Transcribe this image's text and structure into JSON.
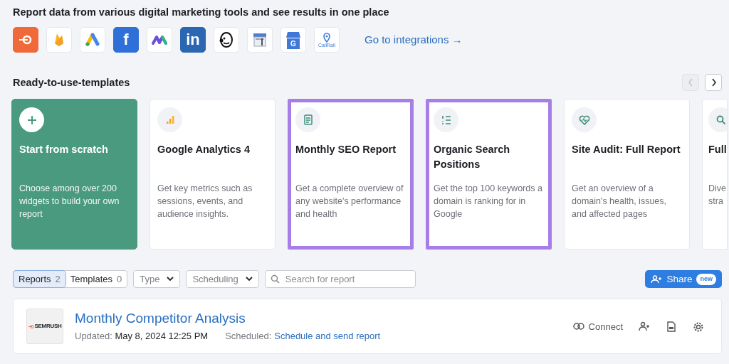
{
  "heading": "Report data from various digital marketing tools and see results in one place",
  "integrations": [
    {
      "kind": "swirl"
    },
    {
      "kind": "flame"
    },
    {
      "kind": "ads"
    },
    {
      "kind": "letter",
      "glyph": "f"
    },
    {
      "kind": "wave"
    },
    {
      "kind": "letter-box",
      "glyph": "in"
    },
    {
      "kind": "monkey"
    },
    {
      "kind": "store-tool"
    },
    {
      "kind": "store",
      "glyph": "G"
    },
    {
      "kind": "pin",
      "glyph": "CallRail"
    }
  ],
  "integrations_link": "Go to integrations →",
  "templates_heading": "Ready-to-use-templates",
  "carousel": {
    "prev_disabled": true,
    "next_disabled": false
  },
  "templates": [
    {
      "kind": "scratch",
      "title": "Start from scratch",
      "description": "Choose among over 200 widgets to build your own report",
      "highlighted": false
    },
    {
      "kind": "template",
      "title": "Google Analytics 4",
      "description": "Get key metrics such as sessions, events, and audience insights.",
      "highlighted": false
    },
    {
      "kind": "template",
      "title": "Monthly SEO Report",
      "description": "Get a complete overview of any website's performance and health",
      "highlighted": true
    },
    {
      "kind": "template",
      "title": "Organic Search Positions",
      "description": "Get the top 100 keywords a domain is ranking for in Google",
      "highlighted": true
    },
    {
      "kind": "template",
      "title": "Site Audit: Full Report",
      "description": "Get an overview of a domain's health, issues, and affected pages",
      "highlighted": false
    },
    {
      "kind": "template",
      "title": "Full",
      "description": "Dive stra",
      "highlighted": false
    }
  ],
  "tabs": [
    {
      "label": "Reports",
      "count": "2",
      "selected": true
    },
    {
      "label": "Templates",
      "count": "0",
      "selected": false
    }
  ],
  "dropdowns": [
    {
      "label": "Type"
    },
    {
      "label": "Scheduling"
    }
  ],
  "search": {
    "placeholder": "Search for report"
  },
  "share": {
    "label": "Share",
    "badge": "new"
  },
  "report": {
    "thumbnail_text": "SEMRUSH",
    "title": "Monthly Competitor Analysis",
    "updated_label": "Updated:",
    "updated_value": "May 8, 2024 12:25 PM",
    "scheduled_label": "Scheduled:",
    "scheduled_link": "Schedule and send report",
    "connect": "Connect"
  }
}
